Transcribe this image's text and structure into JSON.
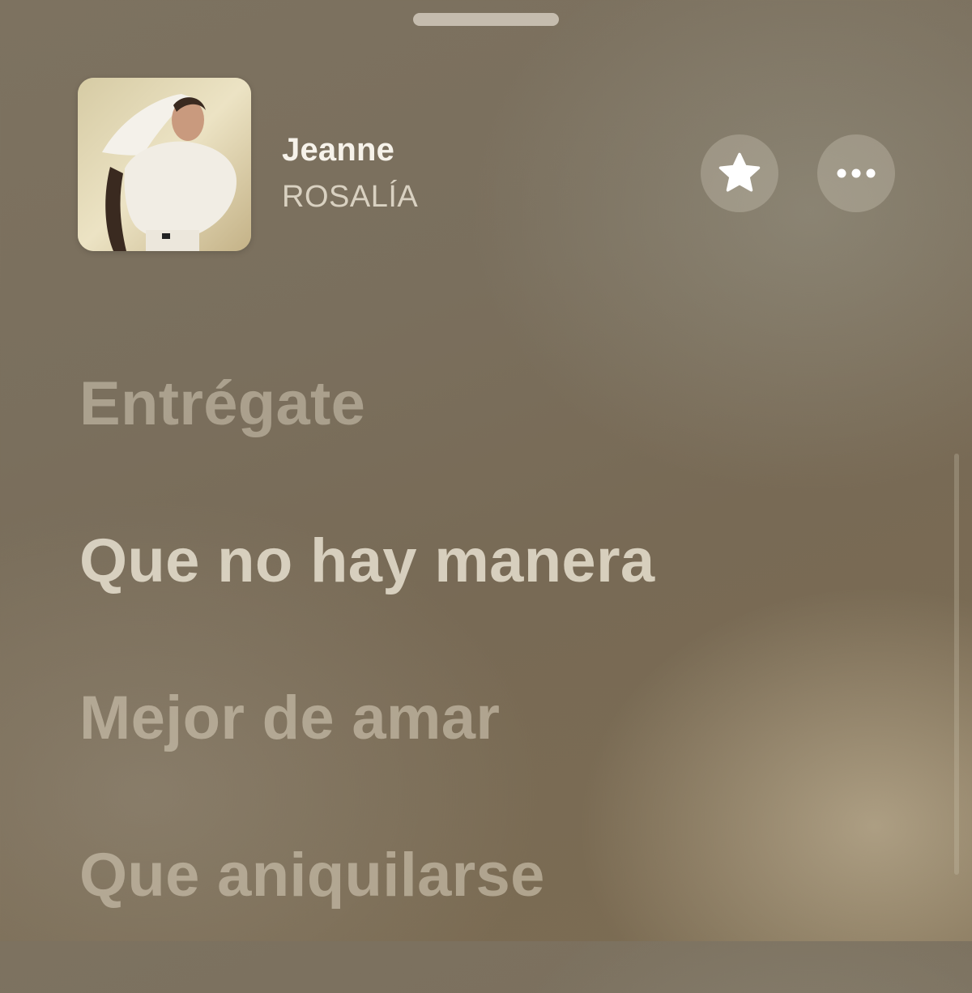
{
  "now_playing": {
    "title": "Jeanne",
    "artist": "ROSALÍA",
    "artwork_icon": "album-artwork"
  },
  "actions": {
    "favorite_icon": "star-icon",
    "more_icon": "ellipsis-icon"
  },
  "lyrics": {
    "lines": [
      {
        "text": "Entrégate",
        "state": "past"
      },
      {
        "text": "Que no hay manera",
        "state": "active"
      },
      {
        "text": "Mejor de amar",
        "state": "upcoming"
      },
      {
        "text": "Que aniquilarse",
        "state": "upcoming"
      }
    ]
  },
  "colors": {
    "background": "#7a6f5d",
    "title": "#f6f2ea",
    "lyric_active": "#e8e0d0"
  }
}
